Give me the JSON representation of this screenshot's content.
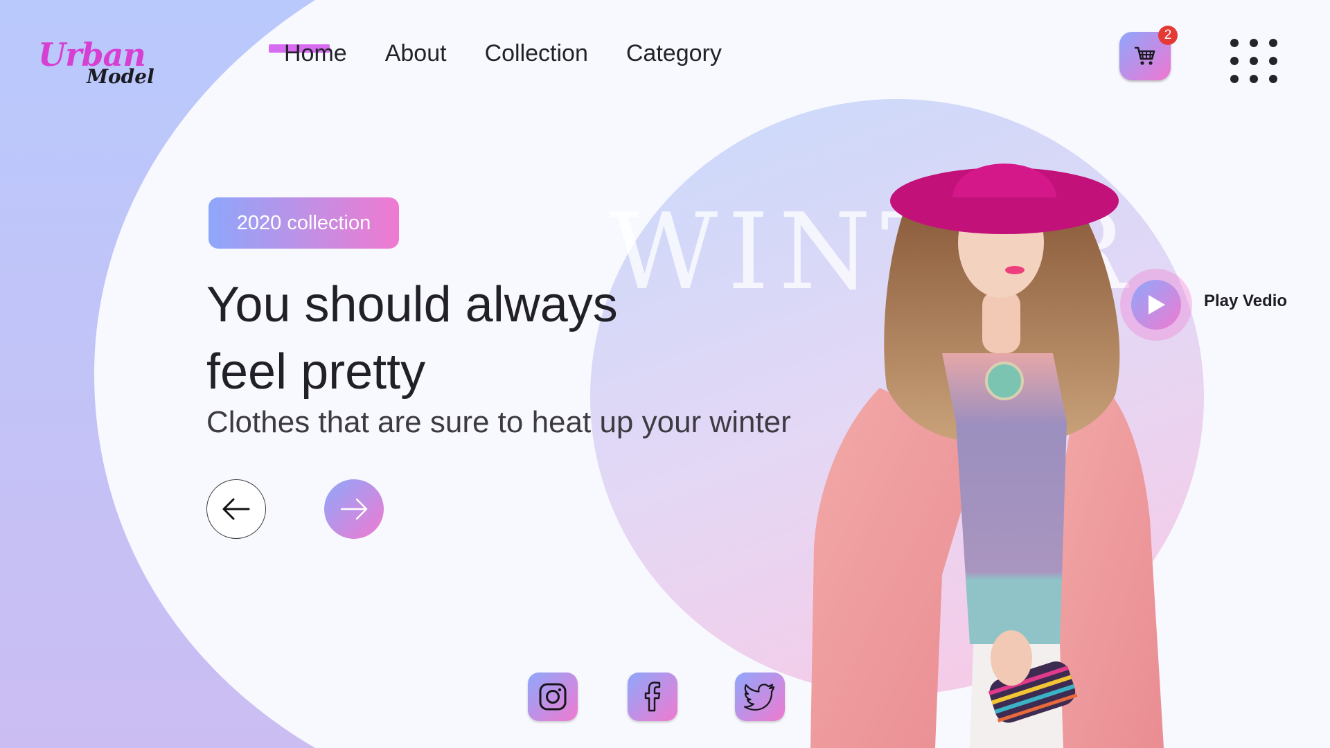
{
  "brand": {
    "logo_line1": "Urban",
    "logo_line2": "Model"
  },
  "nav": {
    "items": [
      {
        "label": "Home",
        "active": true
      },
      {
        "label": "About",
        "active": false
      },
      {
        "label": "Collection",
        "active": false
      },
      {
        "label": "Category",
        "active": false
      }
    ]
  },
  "header": {
    "cart_icon": "cart-icon",
    "cart_count": "2",
    "menu_icon": "grid-dots-icon"
  },
  "hero": {
    "tag": "2020 collection",
    "headline_line1": "You should always",
    "headline_line2": "feel pretty",
    "subheadline": "Clothes that are sure to heat up your winter",
    "background_word": "WINTER",
    "prev_icon": "arrow-left-icon",
    "next_icon": "arrow-right-icon",
    "play_label": "Play Vedio",
    "play_icon": "play-icon"
  },
  "social": {
    "items": [
      {
        "icon": "instagram-icon"
      },
      {
        "icon": "facebook-icon"
      },
      {
        "icon": "twitter-icon"
      }
    ]
  },
  "colors": {
    "accent_gradient_start": "#8ea7fb",
    "accent_gradient_end": "#f07ad0",
    "nav_active": "#d76cf0",
    "logo_pink": "#d63fd2",
    "badge_red": "#e53935",
    "left_shape": "#bccbfb"
  }
}
